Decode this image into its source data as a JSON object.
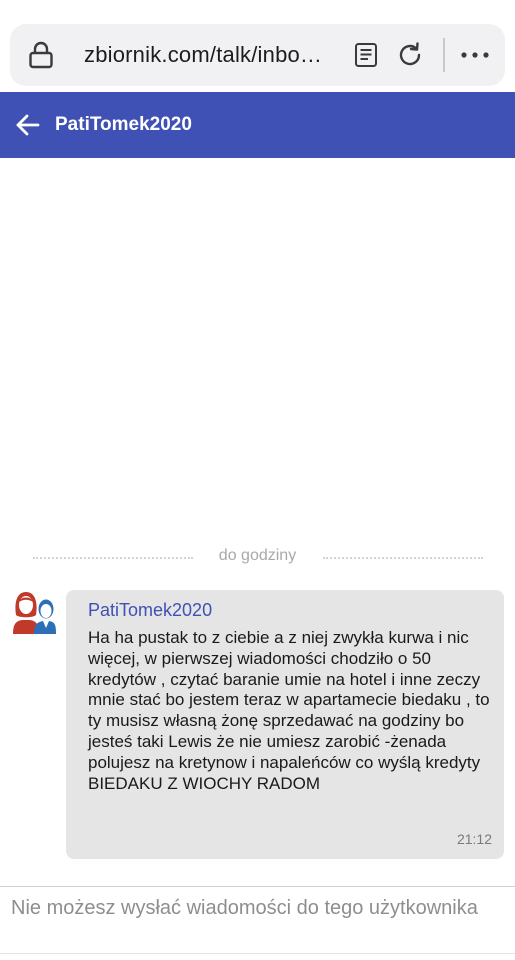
{
  "browser": {
    "url": "zbiornik.com/talk/inbo…",
    "icons": [
      "lock-icon",
      "reader-mode-icon",
      "reload-icon",
      "more-icon"
    ]
  },
  "header": {
    "back_icon": "arrow-left-icon",
    "title": "PatiTomek2020",
    "bg_color": "#3f51b5"
  },
  "conversation": {
    "separator_label": "do godziny",
    "messages": [
      {
        "sender": "PatiTomek2020",
        "text": "Ha ha pustak to z ciebie a z niej zwykła kurwa i nic więcej, w pierwszej wiadomości chodziło o 50 kredytów , czytać baranie umie na hotel i inne zeczy mnie stać bo jestem teraz w apartamecie biedaku , to ty musisz własną żonę sprzedawać na godziny bo jesteś taki Lewis że nie umiesz zarobić -żenada polujesz na kretynow i napaleńców co wyślą kredyty BIEDAKU Z WIOCHY RADOM",
        "time": "21:12"
      }
    ]
  },
  "composer": {
    "notice": "Nie możesz wysłać wiadomości do tego użytkownika"
  }
}
